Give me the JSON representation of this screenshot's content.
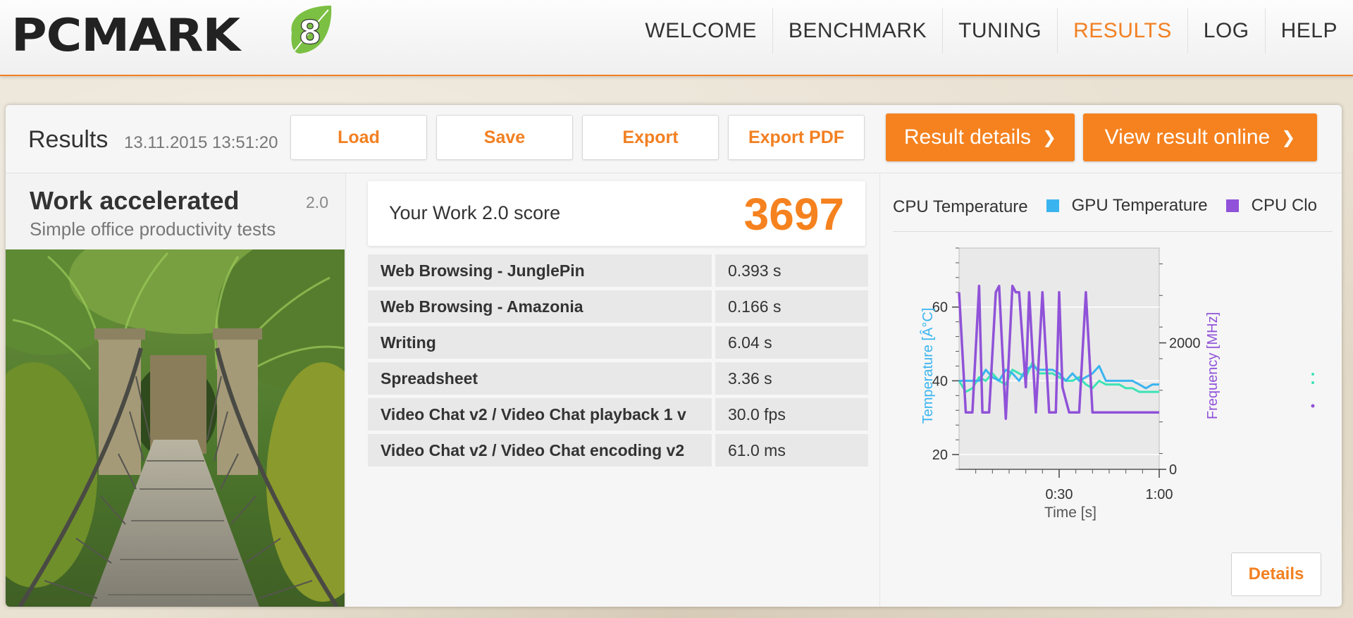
{
  "header": {
    "logo_text": "PCMARK",
    "logo_number": "8",
    "nav": [
      {
        "label": "WELCOME",
        "active": false
      },
      {
        "label": "BENCHMARK",
        "active": false
      },
      {
        "label": "TUNING",
        "active": false
      },
      {
        "label": "RESULTS",
        "active": true
      },
      {
        "label": "LOG",
        "active": false
      },
      {
        "label": "HELP",
        "active": false
      }
    ]
  },
  "results": {
    "title": "Results",
    "date": "13.11.2015 13:51:20",
    "buttons": {
      "load": "Load",
      "save": "Save",
      "export": "Export",
      "export_pdf": "Export PDF",
      "result_details": "Result details",
      "view_online": "View result online"
    }
  },
  "test": {
    "name": "Work accelerated",
    "version": "2.0",
    "subtitle": "Simple office productivity tests",
    "image": "jungle-rope-bridge-photo"
  },
  "score": {
    "label": "Your Work 2.0 score",
    "value": "3697"
  },
  "subtests": [
    {
      "name": "Web Browsing - JunglePin",
      "value": "0.393 s"
    },
    {
      "name": "Web Browsing - Amazonia",
      "value": "0.166 s"
    },
    {
      "name": "Writing",
      "value": "6.04 s"
    },
    {
      "name": "Spreadsheet",
      "value": "3.36 s"
    },
    {
      "name": "Video Chat v2 / Video Chat playback 1 v",
      "value": "30.0 fps"
    },
    {
      "name": "Video Chat v2 / Video Chat encoding v2",
      "value": "61.0 ms"
    }
  ],
  "chart_data": {
    "type": "line",
    "legend": [
      {
        "name": "CPU Temperature",
        "color": "#3de3b4"
      },
      {
        "name": "GPU Temperature",
        "color": "#3ab4ef"
      },
      {
        "name": "CPU Clo",
        "color": "#9052d8"
      }
    ],
    "xlabel": "Time [s]",
    "x_ticks": [
      "0:30",
      "1:00"
    ],
    "xlim": [
      0,
      60
    ],
    "ylabel_left": "Temperature [Â°C]",
    "ylim_left": [
      16,
      76
    ],
    "y_ticks_left": [
      20,
      40,
      60
    ],
    "ylabel_right": "Frequency [MHz]",
    "ylim_right": [
      0,
      3500
    ],
    "y_ticks_right": [
      0,
      2000
    ],
    "series": [
      {
        "name": "CPU Temperature",
        "axis": "left",
        "x": [
          0,
          2,
          4,
          6,
          8,
          10,
          12,
          14,
          16,
          18,
          20,
          22,
          24,
          26,
          28,
          30,
          32,
          34,
          36,
          38,
          40,
          42,
          44,
          46,
          48,
          50,
          52,
          54,
          56,
          58,
          60
        ],
        "values": [
          40,
          37,
          38,
          41,
          40,
          42,
          40,
          39,
          43,
          42,
          41,
          45,
          42,
          42,
          42,
          41,
          40,
          40,
          41,
          39,
          38,
          40,
          39,
          39,
          39,
          38,
          38,
          37,
          37,
          37,
          37
        ]
      },
      {
        "name": "GPU Temperature",
        "axis": "left",
        "x": [
          0,
          2,
          4,
          6,
          8,
          10,
          12,
          14,
          16,
          18,
          20,
          22,
          24,
          26,
          28,
          30,
          32,
          34,
          36,
          38,
          40,
          42,
          44,
          46,
          48,
          50,
          52,
          54,
          56,
          58,
          60
        ],
        "values": [
          40,
          40,
          40,
          40,
          43,
          41,
          40,
          43,
          42,
          40,
          43,
          44,
          43,
          43,
          43,
          42,
          40,
          42,
          40,
          41,
          42,
          44,
          40,
          40,
          40,
          40,
          40,
          39,
          38,
          39,
          39
        ]
      },
      {
        "name": "CPU Clo",
        "axis": "right",
        "x": [
          0,
          2,
          4,
          6,
          7,
          9,
          11,
          12,
          14,
          16,
          17,
          18,
          20,
          21,
          23,
          25,
          27,
          29,
          30,
          31,
          33,
          34,
          36,
          38,
          40,
          41,
          42,
          44,
          46,
          48,
          50,
          52,
          54,
          56,
          58,
          60
        ],
        "values": [
          2800,
          900,
          900,
          2900,
          900,
          900,
          2800,
          2900,
          800,
          2900,
          2800,
          2800,
          1300,
          2800,
          900,
          2800,
          900,
          900,
          2800,
          1300,
          900,
          900,
          900,
          2800,
          900,
          900,
          900,
          900,
          900,
          900,
          900,
          900,
          900,
          900,
          900,
          900
        ]
      }
    ]
  },
  "chart_details_button": "Details"
}
